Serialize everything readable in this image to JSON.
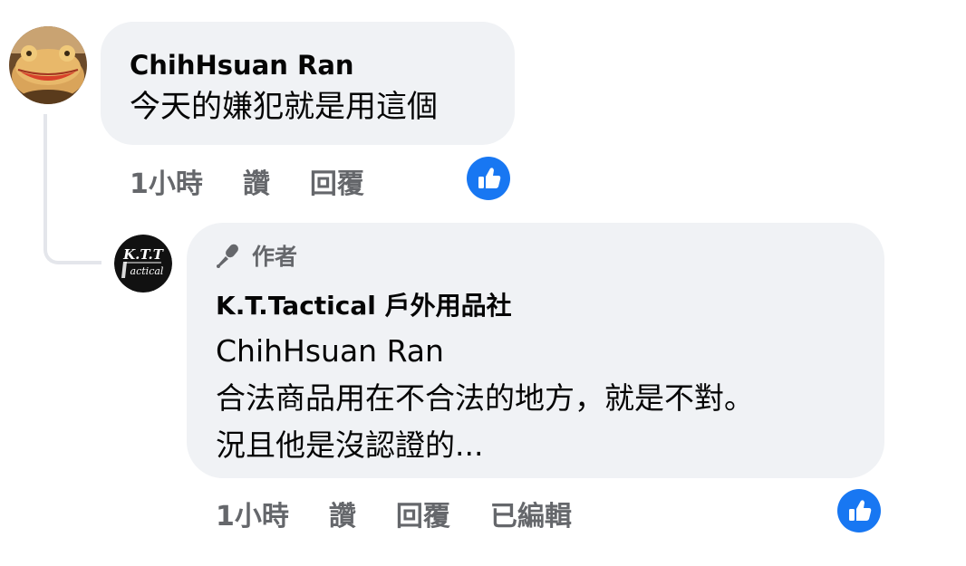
{
  "comment": {
    "author": "ChihHsuan Ran",
    "text": "今天的嫌犯就是用這個",
    "actions": {
      "time": "1小時",
      "like": "讚",
      "reply": "回覆"
    },
    "avatar_icon": "frog-avatar"
  },
  "reply": {
    "badge": "作者",
    "badge_icon": "microphone-icon",
    "author": "K.T.Tactical 戶外用品社",
    "mention": "ChihHsuan Ran",
    "lines": [
      "合法商品用在不合法的地方，就是不對。",
      "況且他是沒認證的..."
    ],
    "actions": {
      "time": "1小時",
      "like": "讚",
      "reply": "回覆",
      "edited": "已編輯"
    },
    "avatar_logo": {
      "line1": "K.T.T",
      "line2": "actical"
    }
  },
  "colors": {
    "bubble": "#f0f2f5",
    "like": "#1877f2",
    "muted": "#65676b"
  }
}
